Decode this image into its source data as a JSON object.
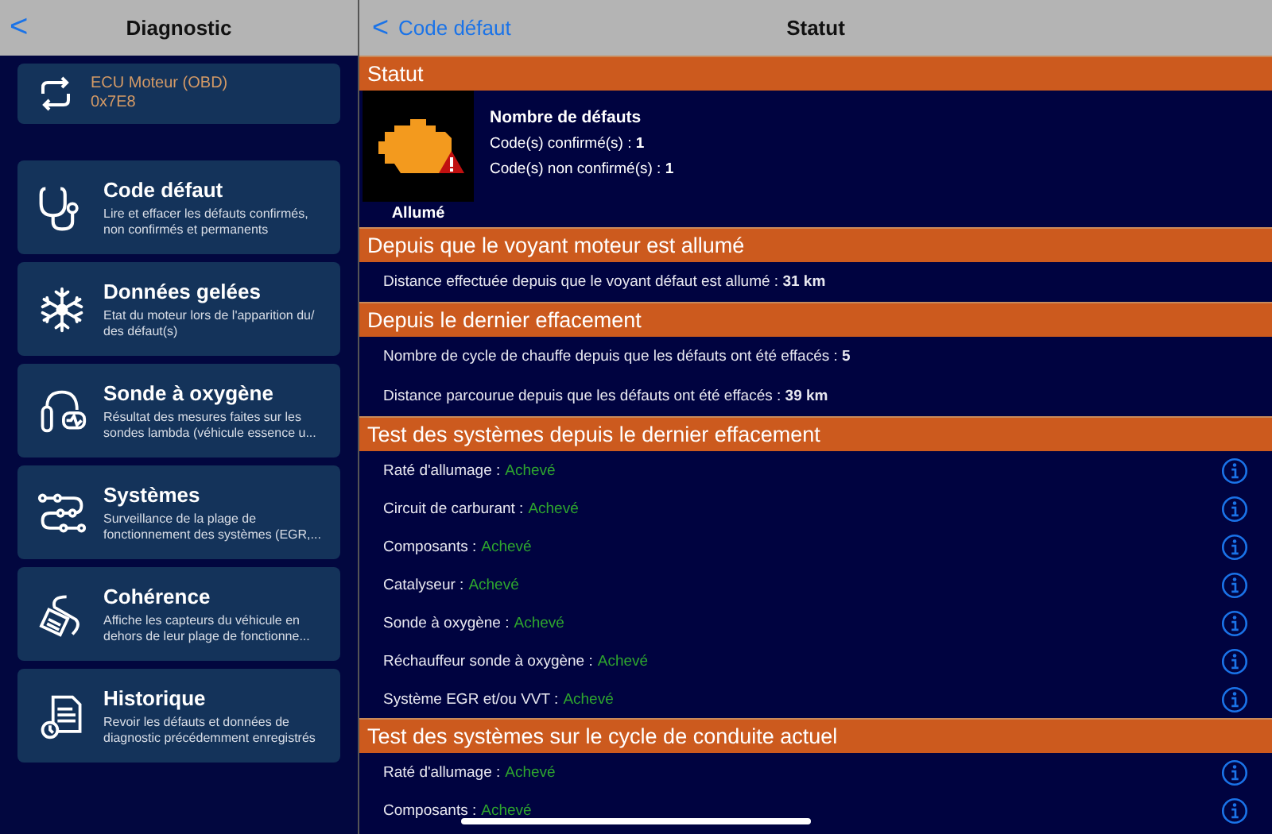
{
  "sidebar": {
    "back": "<",
    "title": "Diagnostic",
    "ecu": {
      "name": "ECU Moteur (OBD)",
      "address": "0x7E8"
    },
    "items": [
      {
        "kind": "stethoscope",
        "title": "Code défaut",
        "description": "Lire et effacer les défauts confirmés, non confirmés et permanents"
      },
      {
        "kind": "snowflake",
        "title": "Données gelées",
        "description": "Etat du moteur lors de l'apparition du/ des défaut(s)"
      },
      {
        "kind": "sensor",
        "title": "Sonde à oxygène",
        "description": "Résultat des mesures faites sur les sondes lambda (véhicule essence u..."
      },
      {
        "kind": "path",
        "title": "Systèmes",
        "description": "Surveillance de la plage de fonctionnement des systèmes (EGR,..."
      },
      {
        "kind": "cable",
        "title": "Cohérence",
        "description": "Affiche les capteurs du véhicule en dehors de leur plage de fonctionne..."
      },
      {
        "kind": "document",
        "title": "Historique",
        "description": "Revoir les défauts et données de diagnostic précédemment enregistrés"
      }
    ]
  },
  "header": {
    "back": "<",
    "back_label": "Code défaut",
    "title": "Statut"
  },
  "status": {
    "title": "Statut",
    "lamp_on": true,
    "lamp_label": "Allumé",
    "heading": "Nombre de défauts",
    "lines": [
      "Code(s) confirmé(s) : **1**",
      "Code(s) non confirmé(s) : **1**"
    ]
  },
  "sections": [
    {
      "kind": "info",
      "title": "Depuis que le voyant moteur est allumé",
      "rows": [
        "Distance effectuée depuis que le voyant défaut est allumé : **31 km**"
      ]
    },
    {
      "kind": "info",
      "title": "Depuis le dernier effacement",
      "rows": [
        "Nombre de cycle de chauffe depuis que les défauts ont été effacés : **5**",
        "Distance parcourue depuis que les défauts ont été effacés : **39 km**"
      ]
    },
    {
      "kind": "tests",
      "title": "Test des systèmes depuis le dernier effacement",
      "tests": [
        {
          "label": "Raté d'allumage :",
          "status": "Achevé",
          "complete": true
        },
        {
          "label": "Circuit de carburant :",
          "status": "Achevé",
          "complete": true
        },
        {
          "label": "Composants :",
          "status": "Achevé",
          "complete": true
        },
        {
          "label": "Catalyseur :",
          "status": "Achevé",
          "complete": true
        },
        {
          "label": "Sonde à oxygène :",
          "status": "Achevé",
          "complete": true
        },
        {
          "label": "Réchauffeur sonde à oxygène :",
          "status": "Achevé",
          "complete": true
        },
        {
          "label": "Système EGR et/ou VVT :",
          "status": "Achevé",
          "complete": true
        }
      ]
    },
    {
      "kind": "tests",
      "title": "Test des systèmes sur le cycle de conduite actuel",
      "tests": [
        {
          "label": "Raté d'allumage :",
          "status": "Achevé",
          "complete": true
        },
        {
          "label": "Composants :",
          "status": "Achevé",
          "complete": true
        }
      ]
    }
  ]
}
